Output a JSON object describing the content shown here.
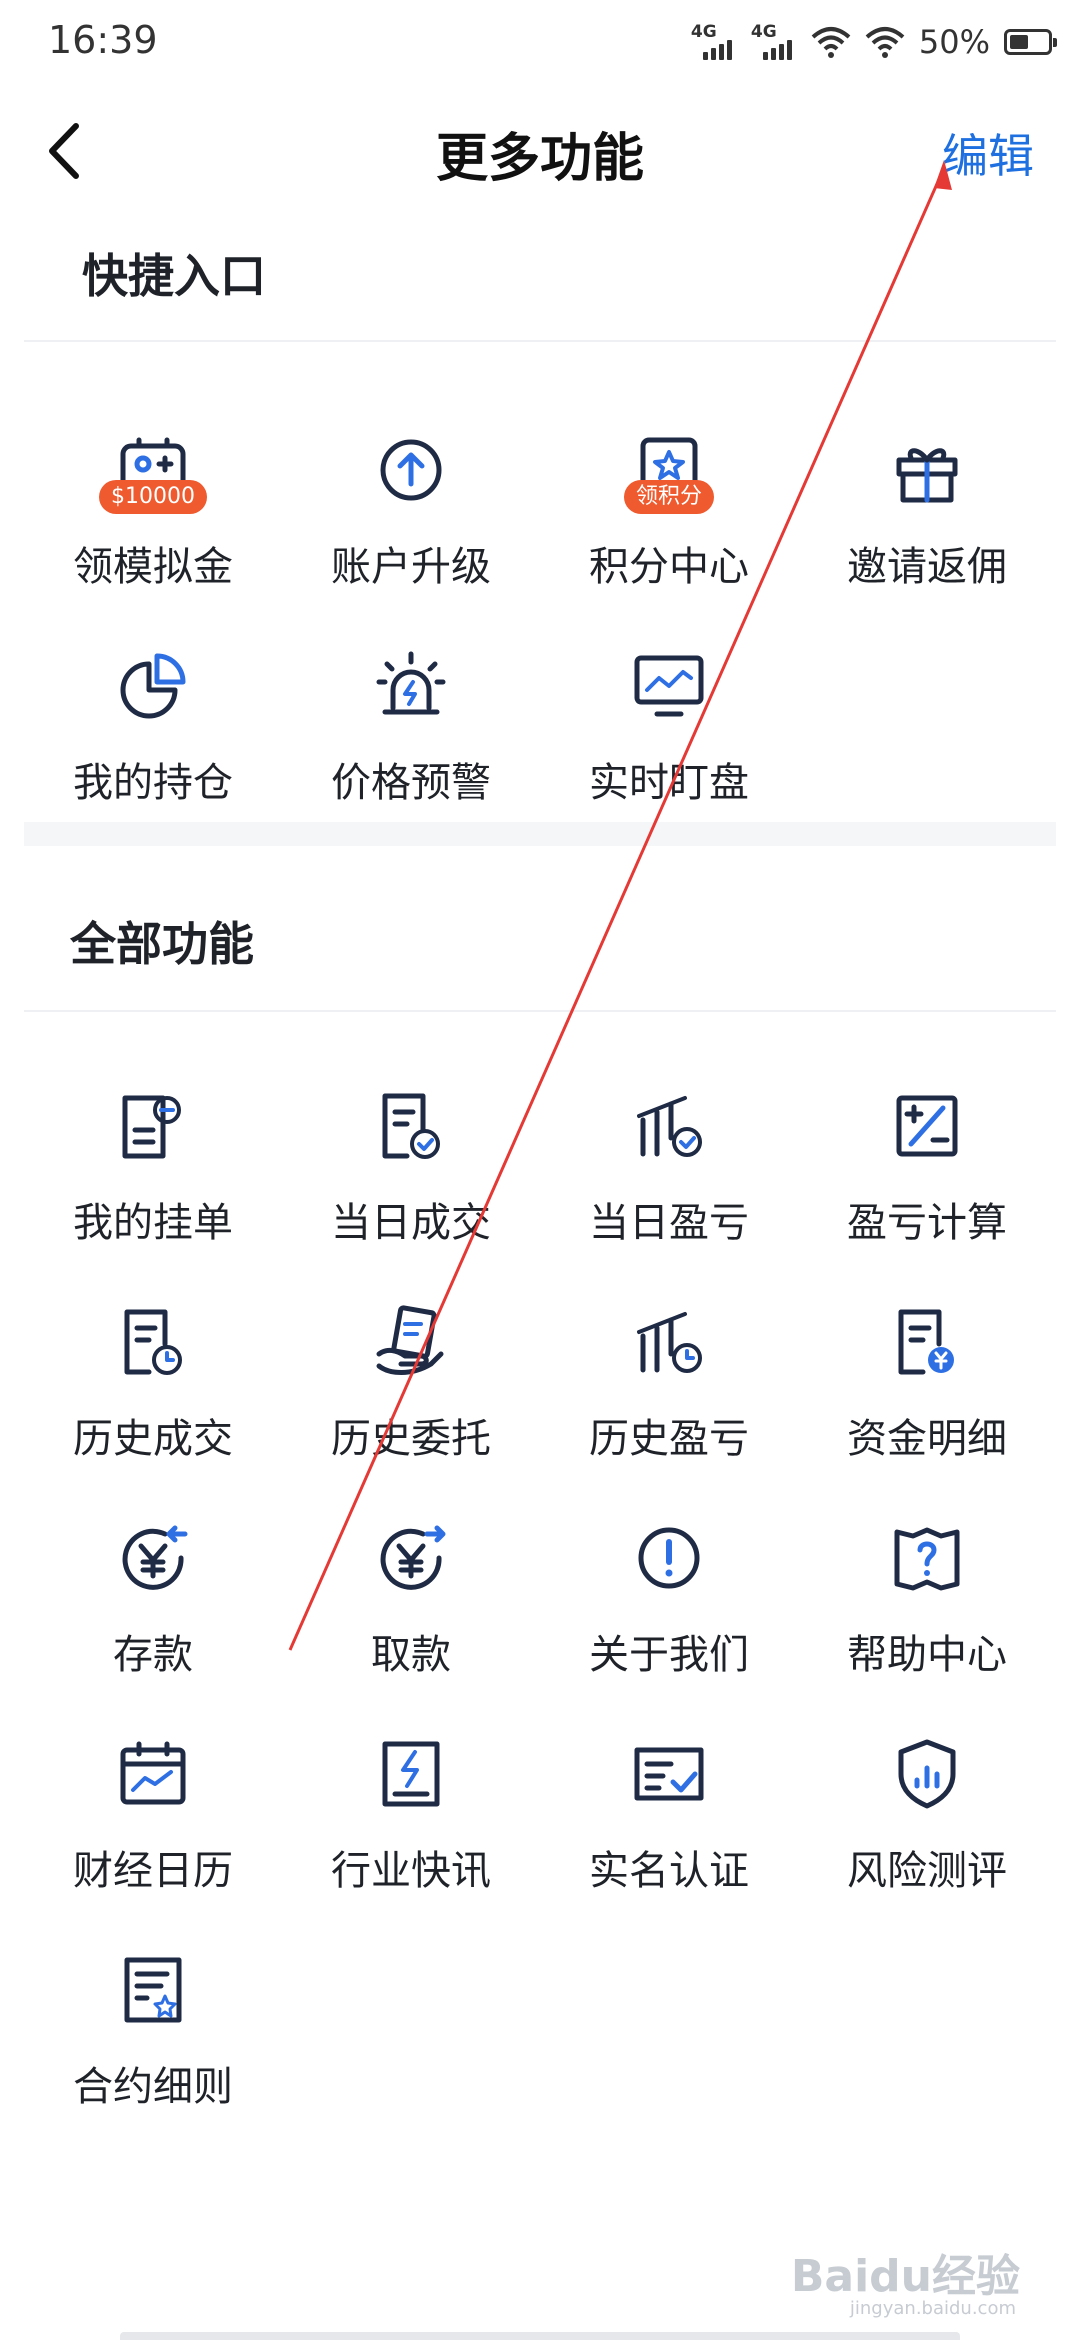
{
  "status": {
    "time": "16:39",
    "net1": "4G",
    "net2": "4G",
    "battery": "50%",
    "battery_level": 0.5
  },
  "nav": {
    "title": "更多功能",
    "edit": "编辑"
  },
  "colors": {
    "accent": "#1e6fe0",
    "icon_dark": "#1f2a44",
    "badge": "#ef5a2e",
    "annotation": "#e53935"
  },
  "quick": {
    "title": "快捷入口",
    "items": [
      {
        "label": "领模拟金",
        "icon": "wallet-plus-icon",
        "badge": "$10000"
      },
      {
        "label": "账户升级",
        "icon": "arrow-up-circle-icon"
      },
      {
        "label": "积分中心",
        "icon": "star-badge-icon",
        "badge": "领积分"
      },
      {
        "label": "邀请返佣",
        "icon": "gift-icon"
      },
      {
        "label": "我的持仓",
        "icon": "pie-chart-icon"
      },
      {
        "label": "价格预警",
        "icon": "alarm-light-icon"
      },
      {
        "label": "实时盯盘",
        "icon": "monitor-chart-icon"
      }
    ]
  },
  "all": {
    "title": "全部功能",
    "items": [
      {
        "label": "我的挂单",
        "icon": "order-doc-icon"
      },
      {
        "label": "当日成交",
        "icon": "doc-check-icon"
      },
      {
        "label": "当日盈亏",
        "icon": "bars-check-icon"
      },
      {
        "label": "盈亏计算",
        "icon": "calculator-icon"
      },
      {
        "label": "历史成交",
        "icon": "doc-clock-icon"
      },
      {
        "label": "历史委托",
        "icon": "hand-doc-icon"
      },
      {
        "label": "历史盈亏",
        "icon": "bars-clock-icon"
      },
      {
        "label": "资金明细",
        "icon": "doc-yen-icon"
      },
      {
        "label": "存款",
        "icon": "yen-deposit-icon"
      },
      {
        "label": "取款",
        "icon": "yen-withdraw-icon"
      },
      {
        "label": "关于我们",
        "icon": "info-circle-icon"
      },
      {
        "label": "帮助中心",
        "icon": "help-book-icon"
      },
      {
        "label": "财经日历",
        "icon": "calendar-chart-icon"
      },
      {
        "label": "行业快讯",
        "icon": "news-flash-icon"
      },
      {
        "label": "实名认证",
        "icon": "id-check-icon"
      },
      {
        "label": "风险测评",
        "icon": "shield-chart-icon"
      },
      {
        "label": "合约细则",
        "icon": "contract-star-icon"
      }
    ]
  },
  "watermark": {
    "brand": "Baidu经验",
    "url": "jingyan.baidu.com"
  }
}
